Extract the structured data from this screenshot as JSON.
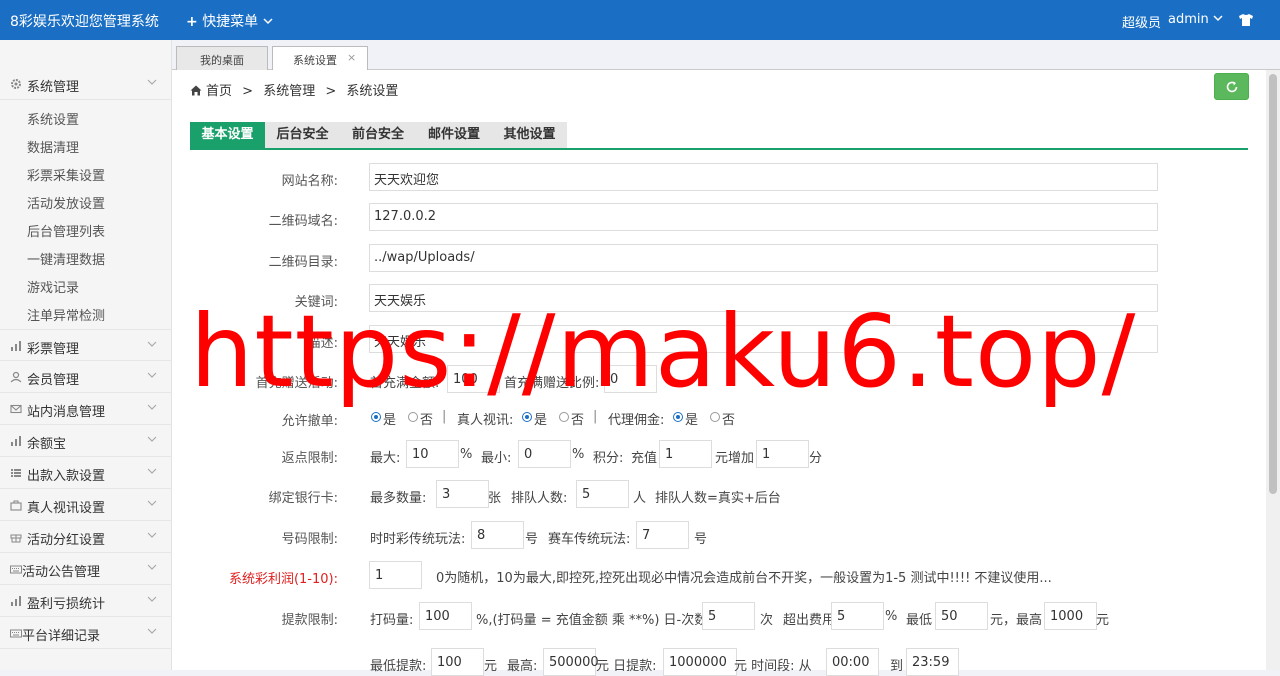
{
  "topbar": {
    "brand": "8彩娱乐欢迎您管理系统",
    "quick_menu": "快捷菜单",
    "role": "超级员",
    "user": "admin"
  },
  "sidebar": {
    "groups": [
      {
        "label": "系统管理",
        "icon": "gear-icon"
      },
      {
        "label": "彩票管理",
        "icon": "bar-chart-icon"
      },
      {
        "label": "会员管理",
        "icon": "user-icon"
      },
      {
        "label": "站内消息管理",
        "icon": "envelope-icon"
      },
      {
        "label": "余额宝",
        "icon": "bar-chart-icon"
      },
      {
        "label": "出款入款设置",
        "icon": "list-icon"
      },
      {
        "label": "真人视讯设置",
        "icon": "briefcase-icon"
      },
      {
        "label": "活动分红设置",
        "icon": "gift-icon"
      },
      {
        "label": "活动公告管理",
        "icon": "keyboard-icon"
      },
      {
        "label": "盈利亏损统计",
        "icon": "bar-chart-icon"
      },
      {
        "label": "平台详细记录",
        "icon": "keyboard-icon"
      }
    ],
    "sub_items": [
      "系统设置",
      "数据清理",
      "彩票采集设置",
      "活动发放设置",
      "后台管理列表",
      "一键清理数据",
      "游戏记录",
      "注单异常检测"
    ]
  },
  "page_tabs": [
    {
      "label": "我的桌面"
    },
    {
      "label": "系统设置",
      "close": "×"
    }
  ],
  "breadcrumb": {
    "home": "首页",
    "sep": ">",
    "level1": "系统管理",
    "level2": "系统设置"
  },
  "settings_tabs": [
    "基本设置",
    "后台安全",
    "前台安全",
    "邮件设置",
    "其他设置"
  ],
  "form": {
    "site_name": {
      "label": "网站名称:",
      "value": "天天欢迎您"
    },
    "qr_domain": {
      "label": "二维码域名:",
      "value": "127.0.0.2"
    },
    "qr_dir": {
      "label": "二维码目录:",
      "value": "../wap/Uploads/"
    },
    "keywords": {
      "label": "关键词:",
      "value": "天天娱乐"
    },
    "description": {
      "label": "描述:",
      "value": "天天娱乐"
    },
    "first_recharge": {
      "label": "首充赠送活动:",
      "min_label": "首充满金额:",
      "min_value": "100",
      "ratio_label": "首充满赠送比例:",
      "ratio_value": "0"
    },
    "allow": {
      "label": "允许撤单:",
      "yes": "是",
      "no": "否",
      "sep": "|",
      "live_label": "真人视讯:",
      "agent_label": "代理佣金:"
    },
    "rebate": {
      "label": "返点限制:",
      "max_label": "最大:",
      "max_value": "10",
      "pct": "%",
      "min_label": "最小:",
      "min_value": "0",
      "points_label": "积分:",
      "recharge_label": "充值",
      "recharge_value": "1",
      "add_label": "元增加",
      "add_value": "1",
      "unit": "分"
    },
    "bank": {
      "label": "绑定银行卡:",
      "max_label": "最多数量:",
      "max_value": "3",
      "max_unit": "张",
      "queue_label": "排队人数:",
      "queue_value": "5",
      "queue_unit": "人",
      "queue_note": "排队人数=真实+后台"
    },
    "number": {
      "label": "号码限制:",
      "ssc_label": "时时彩传统玩法:",
      "ssc_value": "8",
      "ssc_unit": "号",
      "race_label": "赛车传统玩法:",
      "race_value": "7",
      "race_unit": "号"
    },
    "profit": {
      "label": "系统彩利润(1-10):",
      "value": "1",
      "note": "0为随机，10为最大,即控死,控死出现必中情况会造成前台不开奖，一般设置为1-5 测试中!!!! 不建议使用..."
    },
    "withdraw": {
      "label": "提款限制:",
      "bet_label": "打码量:",
      "bet_value": "100",
      "bet_note": "%,(打码量 = 充值金额 乘 **%) 日-次数:",
      "times_value": "5",
      "times_unit": "次",
      "fee_label": "超出费用",
      "fee_value": "5",
      "fee_unit": "%",
      "min_label": "最低",
      "min_value": "50",
      "max_label": "元，最高",
      "max_value": "1000",
      "yuan": "元"
    },
    "withdraw2": {
      "min_label": "最低提款:",
      "min_value": "100",
      "yuan": "元",
      "max_label": "最高:",
      "max_value": "500000",
      "day_label": "元  日提款:",
      "day_value": "1000000",
      "period_label": "元  时间段:  从",
      "from_value": "00:00",
      "to_label": "到",
      "to_value": "23:59"
    }
  },
  "watermark": "https://maku6.top/"
}
